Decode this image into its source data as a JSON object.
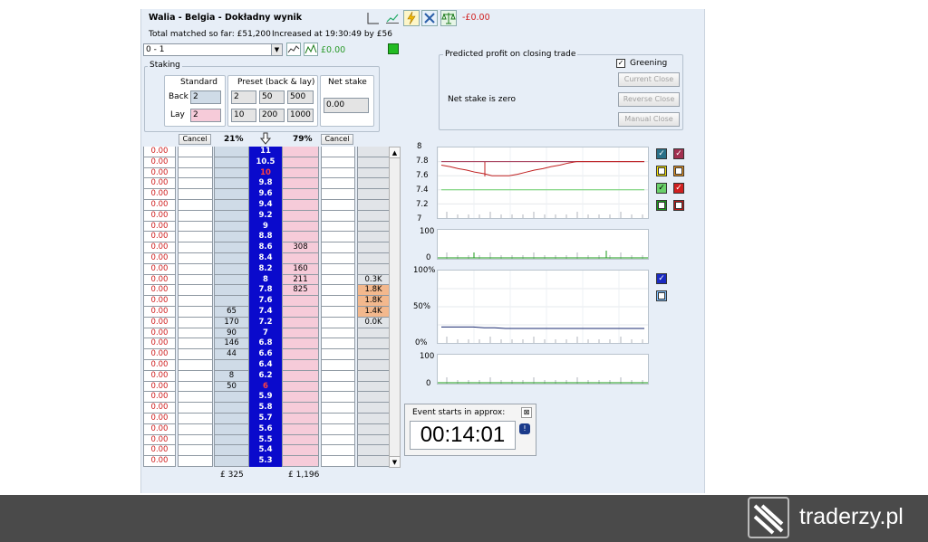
{
  "header": {
    "title": "Walia - Belgia - Dokładny wynik",
    "total_matched": "Total matched so far: £51,200",
    "increased": "Increased at 19:30:49 by £56",
    "pl": "-£0.00"
  },
  "selection": {
    "value": "0 - 1",
    "amount": "£0.00"
  },
  "staking": {
    "legend": "Staking",
    "standard": "Standard",
    "preset": "Preset (back & lay)",
    "net": "Net stake",
    "back_label": "Back",
    "lay_label": "Lay",
    "back_value": "2",
    "lay_value": "2",
    "preset_back": [
      "2",
      "50",
      "500"
    ],
    "preset_lay": [
      "10",
      "200",
      "1000"
    ],
    "net_value": "0.00"
  },
  "profit": {
    "legend": "Predicted profit on closing trade",
    "greening": "Greening",
    "net_zero": "Net stake is zero",
    "current_close": "Current Close",
    "reverse_close": "Reverse Close",
    "manual_close": "Manual Close"
  },
  "ladder_header": {
    "cancel_left": "Cancel",
    "back_pct": "21%",
    "lay_pct": "79%",
    "cancel_right": "Cancel"
  },
  "ladder": [
    {
      "pl": "0.00",
      "price": "11",
      "back": "",
      "lay": "",
      "vol": ""
    },
    {
      "pl": "0.00",
      "price": "10.5",
      "back": "",
      "lay": "",
      "vol": ""
    },
    {
      "pl": "0.00",
      "price": "10",
      "back": "",
      "lay": "",
      "vol": "",
      "red": true
    },
    {
      "pl": "0.00",
      "price": "9.8",
      "back": "",
      "lay": "",
      "vol": ""
    },
    {
      "pl": "0.00",
      "price": "9.6",
      "back": "",
      "lay": "",
      "vol": ""
    },
    {
      "pl": "0.00",
      "price": "9.4",
      "back": "",
      "lay": "",
      "vol": ""
    },
    {
      "pl": "0.00",
      "price": "9.2",
      "back": "",
      "lay": "",
      "vol": ""
    },
    {
      "pl": "0.00",
      "price": "9",
      "back": "",
      "lay": "",
      "vol": ""
    },
    {
      "pl": "0.00",
      "price": "8.8",
      "back": "",
      "lay": "",
      "vol": ""
    },
    {
      "pl": "0.00",
      "price": "8.6",
      "back": "",
      "lay": "308",
      "vol": ""
    },
    {
      "pl": "0.00",
      "price": "8.4",
      "back": "",
      "lay": "",
      "vol": ""
    },
    {
      "pl": "0.00",
      "price": "8.2",
      "back": "",
      "lay": "160",
      "vol": ""
    },
    {
      "pl": "0.00",
      "price": "8",
      "back": "",
      "lay": "211",
      "vol": "0.3K"
    },
    {
      "pl": "0.00",
      "price": "7.8",
      "back": "",
      "lay": "825",
      "vol": "1.8K",
      "hi": true
    },
    {
      "pl": "0.00",
      "price": "7.6",
      "back": "",
      "lay": "",
      "vol": "1.8K",
      "hi": true
    },
    {
      "pl": "0.00",
      "price": "7.4",
      "back": "65",
      "lay": "",
      "vol": "1.4K",
      "hi": true
    },
    {
      "pl": "0.00",
      "price": "7.2",
      "back": "170",
      "lay": "",
      "vol": "0.0K"
    },
    {
      "pl": "0.00",
      "price": "7",
      "back": "90",
      "lay": "",
      "vol": ""
    },
    {
      "pl": "0.00",
      "price": "6.8",
      "back": "146",
      "lay": "",
      "vol": ""
    },
    {
      "pl": "0.00",
      "price": "6.6",
      "back": "44",
      "lay": "",
      "vol": ""
    },
    {
      "pl": "0.00",
      "price": "6.4",
      "back": "",
      "lay": "",
      "vol": ""
    },
    {
      "pl": "0.00",
      "price": "6.2",
      "back": "8",
      "lay": "",
      "vol": ""
    },
    {
      "pl": "0.00",
      "price": "6",
      "back": "50",
      "lay": "",
      "vol": "",
      "red": true
    },
    {
      "pl": "0.00",
      "price": "5.9",
      "back": "",
      "lay": "",
      "vol": ""
    },
    {
      "pl": "0.00",
      "price": "5.8",
      "back": "",
      "lay": "",
      "vol": ""
    },
    {
      "pl": "0.00",
      "price": "5.7",
      "back": "",
      "lay": "",
      "vol": ""
    },
    {
      "pl": "0.00",
      "price": "5.6",
      "back": "",
      "lay": "",
      "vol": ""
    },
    {
      "pl": "0.00",
      "price": "5.5",
      "back": "",
      "lay": "",
      "vol": ""
    },
    {
      "pl": "0.00",
      "price": "5.4",
      "back": "",
      "lay": "",
      "vol": ""
    },
    {
      "pl": "0.00",
      "price": "5.3",
      "back": "",
      "lay": "",
      "vol": ""
    }
  ],
  "ladder_footer": {
    "back_total": "£ 325",
    "lay_total": "£ 1,196"
  },
  "charts": {
    "price_ticks": [
      "8",
      "7.8",
      "7.6",
      "7.4",
      "7.2",
      "7"
    ],
    "vol_ticks_a": [
      "100",
      "0"
    ],
    "pct_ticks": [
      "100%",
      "50%",
      "0%"
    ],
    "vol_ticks_b": [
      "100",
      "0"
    ]
  },
  "chart_data": [
    {
      "type": "line",
      "ylim": [
        7,
        8
      ],
      "series": [
        {
          "values": [
            7.75,
            7.73,
            7.7,
            7.68,
            7.65,
            7.63,
            7.6,
            7.6,
            7.6,
            7.62,
            7.65,
            7.68,
            7.7,
            7.73,
            7.75,
            7.78,
            7.8,
            7.8,
            7.8,
            7.8,
            7.8,
            7.8,
            7.8,
            7.8,
            7.8
          ]
        },
        {
          "values": [
            7.8,
            7.8,
            7.8,
            7.8,
            7.8,
            7.8,
            7.8,
            7.8,
            7.8,
            7.8,
            7.8,
            7.8,
            7.8,
            7.8,
            7.8,
            7.8,
            7.8,
            7.8,
            7.8,
            7.8,
            7.8,
            7.8,
            7.8,
            7.8,
            7.8
          ]
        },
        {
          "values": [
            7.4,
            7.4,
            7.4,
            7.4,
            7.4,
            7.4,
            7.4,
            7.4,
            7.4,
            7.4,
            7.4,
            7.4,
            7.4,
            7.4,
            7.4,
            7.4,
            7.4,
            7.4,
            7.4,
            7.4,
            7.4,
            7.4,
            7.4,
            7.4,
            7.4
          ]
        }
      ]
    },
    {
      "type": "line",
      "ylim": [
        0,
        100
      ],
      "series": [
        {
          "values": [
            22,
            22,
            22,
            22,
            21,
            21,
            20,
            20,
            20,
            20,
            20,
            20,
            20,
            20,
            20,
            20,
            20,
            20,
            20,
            20
          ]
        }
      ]
    }
  ],
  "countdown": {
    "title": "Event starts in approx:",
    "time": "00:14:01"
  },
  "brand": "traderzy.pl"
}
